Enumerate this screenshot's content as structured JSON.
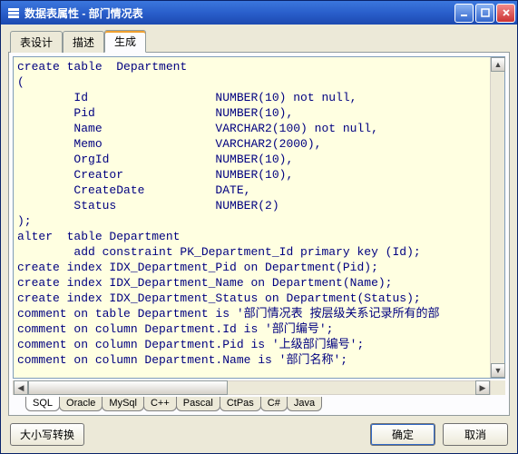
{
  "window": {
    "title": "数据表属性 - 部门情况表"
  },
  "tabs": {
    "top": [
      {
        "label": "表设计",
        "active": false
      },
      {
        "label": "描述",
        "active": false
      },
      {
        "label": "生成",
        "active": true
      }
    ],
    "bottom": [
      {
        "label": "SQL",
        "active": true
      },
      {
        "label": "Oracle",
        "active": false
      },
      {
        "label": "MySql",
        "active": false
      },
      {
        "label": "C++",
        "active": false
      },
      {
        "label": "Pascal",
        "active": false
      },
      {
        "label": "CtPas",
        "active": false
      },
      {
        "label": "C#",
        "active": false
      },
      {
        "label": "Java",
        "active": false
      }
    ]
  },
  "code_lines": [
    "create table  Department",
    "(",
    "        Id                  NUMBER(10) not null,",
    "        Pid                 NUMBER(10),",
    "        Name                VARCHAR2(100) not null,",
    "        Memo                VARCHAR2(2000),",
    "        OrgId               NUMBER(10),",
    "        Creator             NUMBER(10),",
    "        CreateDate          DATE,",
    "        Status              NUMBER(2)",
    ");",
    "alter  table Department",
    "        add constraint PK_Department_Id primary key (Id);",
    "create index IDX_Department_Pid on Department(Pid);",
    "create index IDX_Department_Name on Department(Name);",
    "create index IDX_Department_Status on Department(Status);",
    "comment on table Department is '部门情况表 按层级关系记录所有的部",
    "comment on column Department.Id is '部门编号';",
    "comment on column Department.Pid is '上级部门编号';",
    "comment on column Department.Name is '部门名称';"
  ],
  "buttons": {
    "case_convert": "大小写转换",
    "ok": "确定",
    "cancel": "取消"
  }
}
